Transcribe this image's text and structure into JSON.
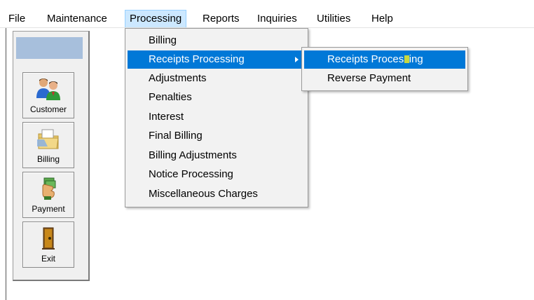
{
  "menubar": {
    "items": [
      {
        "label": "File"
      },
      {
        "label": "Maintenance"
      },
      {
        "label": "Processing"
      },
      {
        "label": "Reports"
      },
      {
        "label": "Inquiries"
      },
      {
        "label": "Utilities"
      },
      {
        "label": "Help"
      }
    ],
    "active_item": "Processing"
  },
  "toolbar": {
    "buttons": [
      {
        "label": "Customer",
        "icon": "customers-icon"
      },
      {
        "label": "Billing",
        "icon": "billing-folder-icon"
      },
      {
        "label": "Payment",
        "icon": "payment-money-icon"
      },
      {
        "label": "Exit",
        "icon": "exit-door-icon"
      }
    ]
  },
  "processing_menu": {
    "items": [
      {
        "label": "Billing"
      },
      {
        "label": "Receipts Processing",
        "has_submenu": true,
        "highlighted": true
      },
      {
        "label": "Adjustments"
      },
      {
        "label": "Penalties"
      },
      {
        "label": "Interest"
      },
      {
        "label": "Final Billing"
      },
      {
        "label": "Billing Adjustments"
      },
      {
        "label": "Notice Processing"
      },
      {
        "label": "Miscellaneous Charges"
      }
    ]
  },
  "receipts_submenu": {
    "items": [
      {
        "label": "Receipts Processing",
        "highlighted": true
      },
      {
        "label": "Reverse Payment"
      }
    ]
  },
  "colors": {
    "highlight": "#0078d7",
    "menu_active_bg": "#cce8ff",
    "panel_header": "#a7bfdc",
    "menu_bg": "#f2f2f2"
  }
}
